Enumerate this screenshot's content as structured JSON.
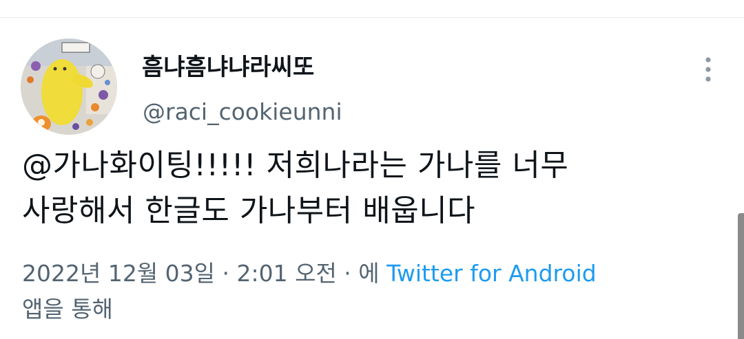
{
  "tweet": {
    "author": {
      "display_name": "흠냐흠냐냐라씨또",
      "handle": "@raci_cookieunni",
      "avatar": "yellow-plush-character-avatar"
    },
    "text_lines": [
      "@가나화이팅!!!!! 저희나라는 가나를 너무",
      "사랑해서 한글도 가나부터 배웁니다"
    ],
    "meta": {
      "timestamp": "2022년 12월 03일 · 2:01 오전 · 에",
      "source": "Twitter for Android",
      "suffix": "앱을 통해"
    },
    "more_icon": "vertical-ellipsis-icon"
  },
  "colors": {
    "text_primary": "#0f1419",
    "text_secondary": "#536471",
    "link": "#1d9bf0",
    "divider": "#e6ecf0"
  }
}
